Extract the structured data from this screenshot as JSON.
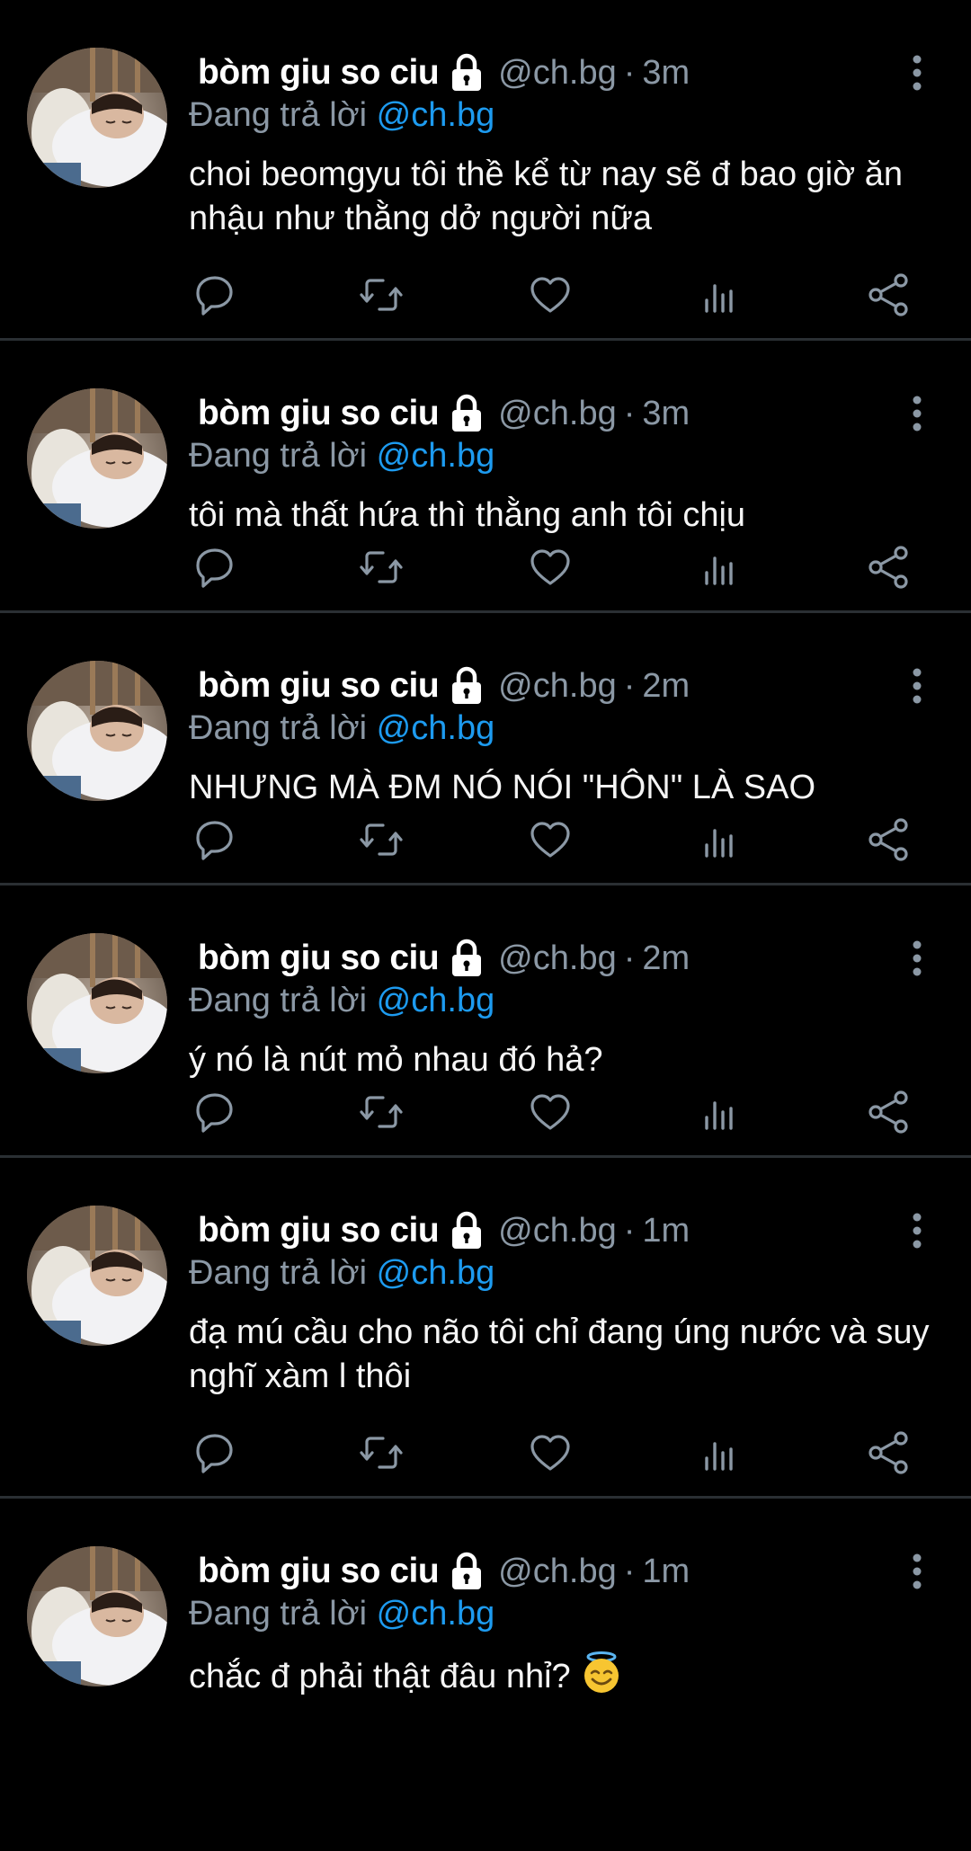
{
  "colors": {
    "background": "#000000",
    "name": "#ffffff",
    "muted": "#8b98a5",
    "link": "#1d9bf0",
    "divider": "#2a2f33"
  },
  "tweets": [
    {
      "name": "bòm giu so ciu",
      "handle": "@ch.bg",
      "separator": "·",
      "time": "3m",
      "reply_label": "Đang trả lời",
      "reply_to": "@ch.bg",
      "text": "choi beomgyu tôi thề kể từ nay sẽ đ bao giờ ăn nhậu như thằng dở người nữa"
    },
    {
      "name": "bòm giu so ciu",
      "handle": "@ch.bg",
      "separator": "·",
      "time": "3m",
      "reply_label": "Đang trả lời",
      "reply_to": "@ch.bg",
      "text": "tôi mà thất hứa thì thằng anh tôi chịu"
    },
    {
      "name": "bòm giu so ciu",
      "handle": "@ch.bg",
      "separator": "·",
      "time": "2m",
      "reply_label": "Đang trả lời",
      "reply_to": "@ch.bg",
      "text": "NHƯNG MÀ ĐM NÓ NÓI \"HÔN\" LÀ SAO"
    },
    {
      "name": "bòm giu so ciu",
      "handle": "@ch.bg",
      "separator": "·",
      "time": "2m",
      "reply_label": "Đang trả lời",
      "reply_to": "@ch.bg",
      "text": "ý nó là nút mỏ nhau đó hả?"
    },
    {
      "name": "bòm giu so ciu",
      "handle": "@ch.bg",
      "separator": "·",
      "time": "1m",
      "reply_label": "Đang trả lời",
      "reply_to": "@ch.bg",
      "text": "đạ mú cầu cho não tôi chỉ đang úng nước và suy nghĩ xàm l thôi"
    },
    {
      "name": "bòm giu so ciu",
      "handle": "@ch.bg",
      "separator": "·",
      "time": "1m",
      "reply_label": "Đang trả lời",
      "reply_to": "@ch.bg",
      "text": "chắc đ phải thật đâu nhỉ?",
      "emoji": "smiling-face-with-halo"
    }
  ],
  "icons": {
    "lock": "lock-icon",
    "more": "more-vertical-icon",
    "reply": "reply-icon",
    "retweet": "retweet-icon",
    "like": "heart-icon",
    "views": "views-icon",
    "share": "share-icon"
  }
}
